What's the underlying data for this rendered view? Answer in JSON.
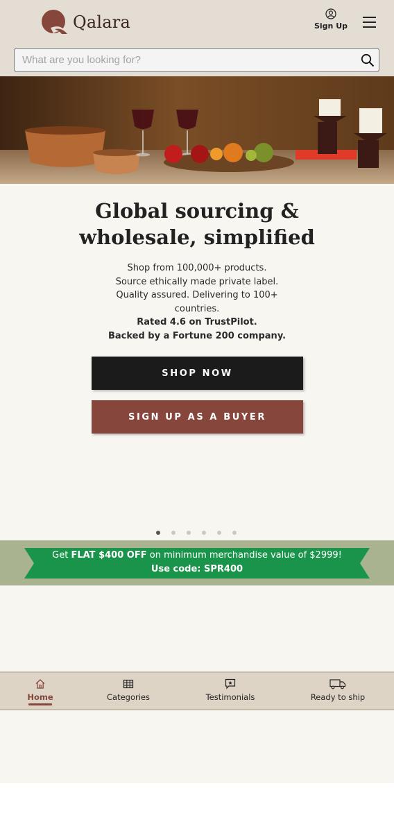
{
  "header": {
    "brand": "Qalara",
    "signup_label": "Sign Up"
  },
  "search": {
    "placeholder": "What are you looking for?",
    "value": ""
  },
  "hero": {
    "title_line1": "Global sourcing &",
    "title_line2": "wholesale, simplified",
    "desc_lines": [
      "Shop from 100,000+ products.",
      "Source ethically made private label.",
      "Quality assured. Delivering to 100+",
      "countries."
    ],
    "desc_bold_lines": [
      "Rated 4.6 on TrustPilot.",
      "Backed by a Fortune 200 company."
    ],
    "shop_now_label": "SHOP NOW",
    "signup_buyer_label": "SIGN UP AS A BUYER",
    "slide_count": 6,
    "active_slide": 1
  },
  "promo": {
    "line1_prefix": "Get ",
    "line1_bold": "FLAT $400 OFF",
    "line1_suffix": " on minimum merchandise value of $2999!",
    "line2": "Use code: SPR400"
  },
  "bottom_nav": {
    "items": [
      {
        "label": "Home",
        "icon": "home-icon",
        "active": true
      },
      {
        "label": "Categories",
        "icon": "grid-icon",
        "active": false
      },
      {
        "label": "Testimonials",
        "icon": "chat-star-icon",
        "active": false
      },
      {
        "label": "Ready to ship",
        "icon": "truck-icon",
        "active": false
      }
    ]
  },
  "colors": {
    "header_bg": "#e3ddd3",
    "page_bg": "#f8f6f1",
    "brand": "#86463b",
    "dark_button": "#1b1b1b",
    "promo_band": "#a9b38f",
    "promo_ribbon": "#1a944a",
    "nav_bg": "#ddd4c6"
  }
}
